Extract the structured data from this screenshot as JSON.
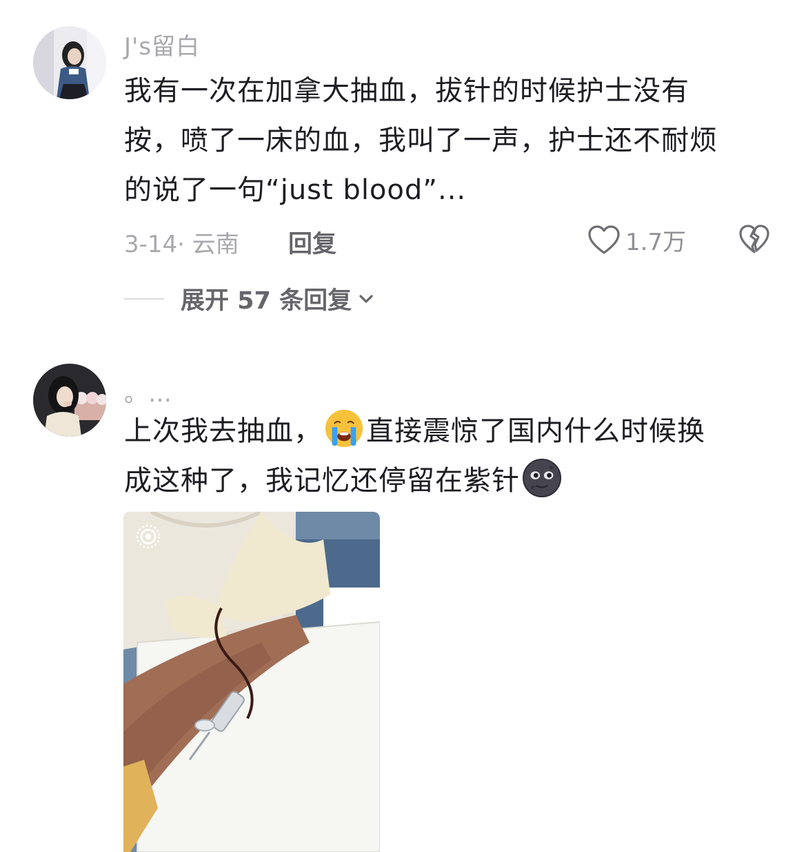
{
  "comments": [
    {
      "username": "J's留白",
      "text_lines": [
        "我有一次在加拿大抽血，拔针的时候护士没有",
        "按，喷了一床的血，我叫了一声，护士还不耐烦",
        "的说了一句“just blood”..."
      ],
      "date": "3-14",
      "separator": "·",
      "location": "云南",
      "reply_label": "回复",
      "like_count": "1.7万",
      "expand_replies_label": "展开 57 条回复"
    },
    {
      "username": "。…",
      "text_part1": "上次我去抽血，",
      "text_part2": "直接震惊了国内什么时候换",
      "text_part3": "成这种了，我记忆还停留在紫针",
      "emoji_1": "crying-face-emoji",
      "emoji_2": "new-moon-face-emoji",
      "has_photo": true,
      "photo_badge_icon": "live-photo-icon"
    }
  ],
  "colors": {
    "username": "#a8a8ad",
    "text": "#1d1d22",
    "meta": "#a8a8ad",
    "action": "#65656b",
    "icon_stroke": "#6e6e73"
  }
}
